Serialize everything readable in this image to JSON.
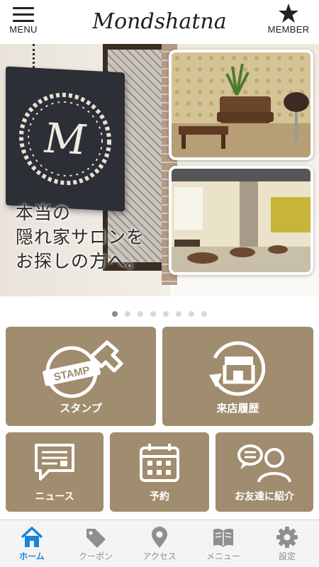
{
  "header": {
    "menu_label": "MENU",
    "logo_text": "Mondshatna",
    "member_label": "MEMBER"
  },
  "hero": {
    "sign_letter": "M",
    "lines": [
      "本当の",
      "隠れ家サロンを",
      "お探しの方へ。"
    ]
  },
  "carousel": {
    "total_slides": 8,
    "active_index": 0
  },
  "tiles": {
    "stamp": {
      "label": "スタンプ",
      "icon_text": "STAMP",
      "icon": "stamp-icon"
    },
    "visit_history": {
      "label": "来店履歴",
      "icon": "storefront-history-icon"
    },
    "news": {
      "label": "ニュース",
      "icon": "message-icon"
    },
    "reservation": {
      "label": "予約",
      "icon": "calendar-icon"
    },
    "refer_friend": {
      "label": "お友達に紹介",
      "icon": "refer-friend-icon"
    }
  },
  "tabbar": {
    "items": [
      {
        "label": "ホーム",
        "icon": "home-icon",
        "active": true
      },
      {
        "label": "クーポン",
        "icon": "coupon-tag-icon",
        "active": false
      },
      {
        "label": "アクセス",
        "icon": "location-pin-icon",
        "active": false
      },
      {
        "label": "メニュー",
        "icon": "menu-book-icon",
        "active": false
      },
      {
        "label": "設定",
        "icon": "gear-icon",
        "active": false
      }
    ]
  },
  "colors": {
    "tile_bg": "#a08c6e",
    "tab_active": "#1a84d8",
    "tab_inactive": "#8f8f8f"
  }
}
